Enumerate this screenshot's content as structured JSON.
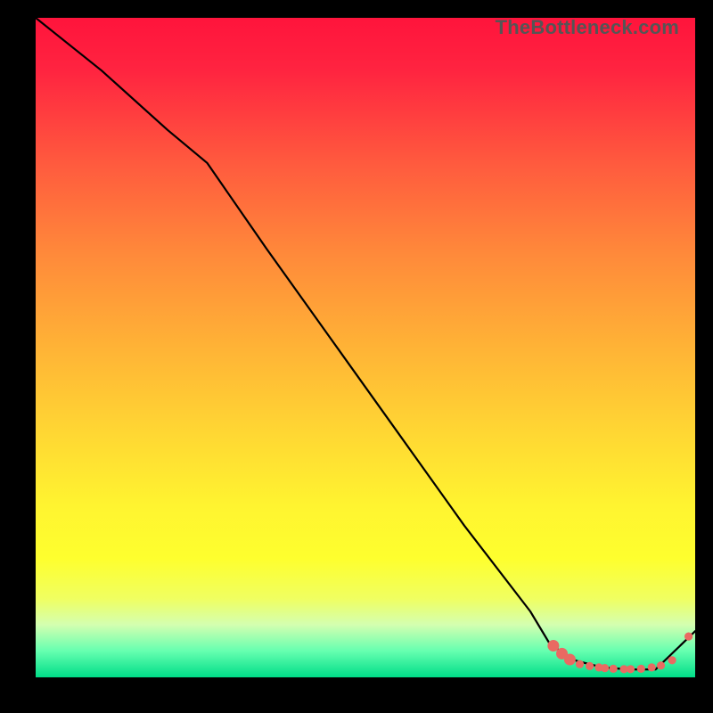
{
  "watermark": "TheBottleneck.com",
  "colors": {
    "gradient_top": "#ff143c",
    "gradient_mid": "#fff430",
    "gradient_bottom": "#00dd88",
    "dot": "#e96a62",
    "line": "#000000",
    "frame_bg": "#000000"
  },
  "chart_data": {
    "type": "line",
    "title": "",
    "xlabel": "",
    "ylabel": "",
    "xlim": [
      0,
      100
    ],
    "ylim": [
      0,
      100
    ],
    "grid": false,
    "legend": false,
    "series": [
      {
        "name": "curve",
        "x": [
          0,
          10,
          20,
          26,
          35,
          45,
          55,
          65,
          75,
          78,
          82,
          86,
          90,
          94,
          100
        ],
        "y": [
          100,
          92,
          83,
          78,
          65,
          51,
          37,
          23,
          10,
          5,
          2.5,
          1.5,
          1.2,
          1.2,
          7
        ],
        "style": "solid"
      }
    ],
    "markers": [
      {
        "x": 78.5,
        "y": 4.8,
        "size": "big"
      },
      {
        "x": 79.8,
        "y": 3.6,
        "size": "big"
      },
      {
        "x": 81.0,
        "y": 2.7,
        "size": "big"
      },
      {
        "x": 82.5,
        "y": 2.0,
        "size": "small"
      },
      {
        "x": 84.0,
        "y": 1.7,
        "size": "small"
      },
      {
        "x": 85.4,
        "y": 1.5,
        "size": "small"
      },
      {
        "x": 86.3,
        "y": 1.4,
        "size": "small"
      },
      {
        "x": 87.6,
        "y": 1.3,
        "size": "small"
      },
      {
        "x": 89.2,
        "y": 1.25,
        "size": "small"
      },
      {
        "x": 90.2,
        "y": 1.25,
        "size": "small"
      },
      {
        "x": 91.8,
        "y": 1.3,
        "size": "small"
      },
      {
        "x": 93.4,
        "y": 1.5,
        "size": "small"
      },
      {
        "x": 94.8,
        "y": 1.8,
        "size": "small"
      },
      {
        "x": 96.5,
        "y": 2.6,
        "size": "small"
      },
      {
        "x": 99.0,
        "y": 6.2,
        "size": "small"
      }
    ]
  }
}
